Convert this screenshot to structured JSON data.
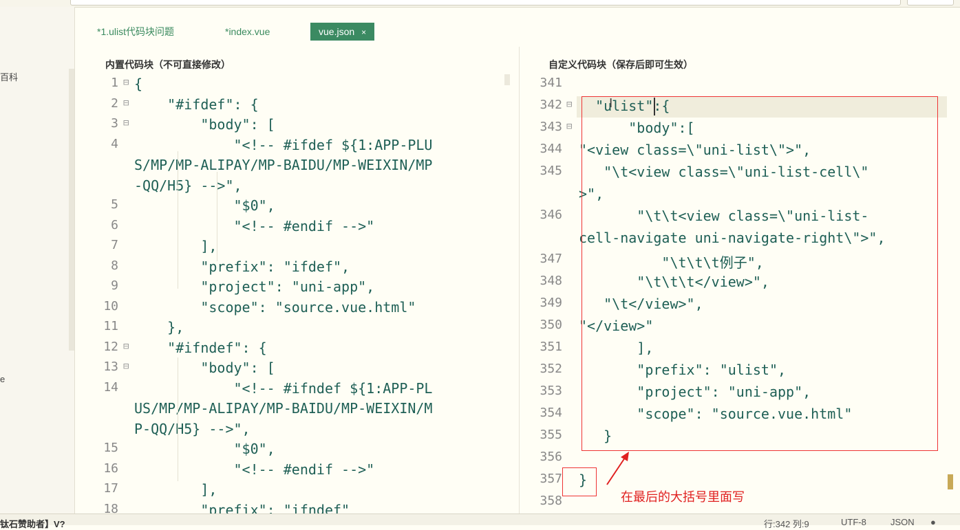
{
  "sidebar": {
    "label_1": "百科",
    "label_2": "e"
  },
  "tabs": [
    {
      "label": "*1.ulist代码块问题"
    },
    {
      "label": "*index.vue"
    },
    {
      "label": "vue.json",
      "close": "×"
    }
  ],
  "left_pane": {
    "title": "内置代码块（不可直接修改）",
    "lines": [
      {
        "n": "1",
        "fold": "⊟",
        "text": "{"
      },
      {
        "n": "2",
        "fold": "⊟",
        "text": "    \"#ifdef\": {"
      },
      {
        "n": "3",
        "fold": "⊟",
        "text": "        \"body\": ["
      },
      {
        "n": "4",
        "fold": "",
        "text": "            \"<!-- #ifdef ${1:APP-PLU"
      },
      {
        "n": "",
        "fold": "",
        "text": "S/MP/MP-ALIPAY/MP-BAIDU/MP-WEIXIN/MP"
      },
      {
        "n": "",
        "fold": "",
        "text": "-QQ/H5} -->\","
      },
      {
        "n": "5",
        "fold": "",
        "text": "            \"$0\","
      },
      {
        "n": "6",
        "fold": "",
        "text": "            \"<!-- #endif -->\""
      },
      {
        "n": "7",
        "fold": "",
        "text": "        ],"
      },
      {
        "n": "8",
        "fold": "",
        "text": "        \"prefix\": \"ifdef\","
      },
      {
        "n": "9",
        "fold": "",
        "text": "        \"project\": \"uni-app\","
      },
      {
        "n": "10",
        "fold": "",
        "text": "        \"scope\": \"source.vue.html\""
      },
      {
        "n": "11",
        "fold": "",
        "text": "    },"
      },
      {
        "n": "12",
        "fold": "⊟",
        "text": "    \"#ifndef\": {"
      },
      {
        "n": "13",
        "fold": "⊟",
        "text": "        \"body\": ["
      },
      {
        "n": "14",
        "fold": "",
        "text": "            \"<!-- #ifndef ${1:APP-PL"
      },
      {
        "n": "",
        "fold": "",
        "text": "US/MP/MP-ALIPAY/MP-BAIDU/MP-WEIXIN/M"
      },
      {
        "n": "",
        "fold": "",
        "text": "P-QQ/H5} -->\","
      },
      {
        "n": "15",
        "fold": "",
        "text": "            \"$0\","
      },
      {
        "n": "16",
        "fold": "",
        "text": "            \"<!-- #endif -->\""
      },
      {
        "n": "17",
        "fold": "",
        "text": "        ],"
      },
      {
        "n": "18",
        "fold": "",
        "text": "        \"prefix\": \"ifndef\""
      }
    ]
  },
  "right_pane": {
    "title": "自定义代码块（保存后即可生效）",
    "lines": [
      {
        "n": "341",
        "fold": "",
        "text": ""
      },
      {
        "n": "342",
        "fold": "⊟",
        "text": "  \"ulist\":{"
      },
      {
        "n": "343",
        "fold": "⊟",
        "text": "      \"body\":["
      },
      {
        "n": "344",
        "fold": "",
        "text": "\"<view class=\\\"uni-list\\\">\","
      },
      {
        "n": "345",
        "fold": "",
        "text": "   \"\\t<view class=\\\"uni-list-cell\\\""
      },
      {
        "n": "",
        "fold": "",
        "text": ">\","
      },
      {
        "n": "346",
        "fold": "",
        "text": "       \"\\t\\t<view class=\\\"uni-list-"
      },
      {
        "n": "",
        "fold": "",
        "text": "cell-navigate uni-navigate-right\\\">\","
      },
      {
        "n": "347",
        "fold": "",
        "text": "          \"\\t\\t\\t例子\","
      },
      {
        "n": "348",
        "fold": "",
        "text": "       \"\\t\\t\\t</view>\","
      },
      {
        "n": "349",
        "fold": "",
        "text": "   \"\\t</view>\","
      },
      {
        "n": "350",
        "fold": "",
        "text": "\"</view>\""
      },
      {
        "n": "351",
        "fold": "",
        "text": "       ],"
      },
      {
        "n": "352",
        "fold": "",
        "text": "       \"prefix\": \"ulist\","
      },
      {
        "n": "353",
        "fold": "",
        "text": "       \"project\": \"uni-app\","
      },
      {
        "n": "354",
        "fold": "",
        "text": "       \"scope\": \"source.vue.html\""
      },
      {
        "n": "355",
        "fold": "",
        "text": "   }"
      },
      {
        "n": "356",
        "fold": "",
        "text": ""
      },
      {
        "n": "357",
        "fold": "",
        "text": "}"
      },
      {
        "n": "358",
        "fold": "",
        "text": ""
      }
    ]
  },
  "annotation": {
    "text": "在最后的大括号里面写"
  },
  "status": {
    "left": "钛石赞助者】V?",
    "row_col": "行:342  列:9",
    "encoding": "UTF-8",
    "language": "JSON"
  },
  "colors": {
    "accent": "#3b8a62",
    "code": "#1e5f55",
    "annotation": "#e02020"
  }
}
